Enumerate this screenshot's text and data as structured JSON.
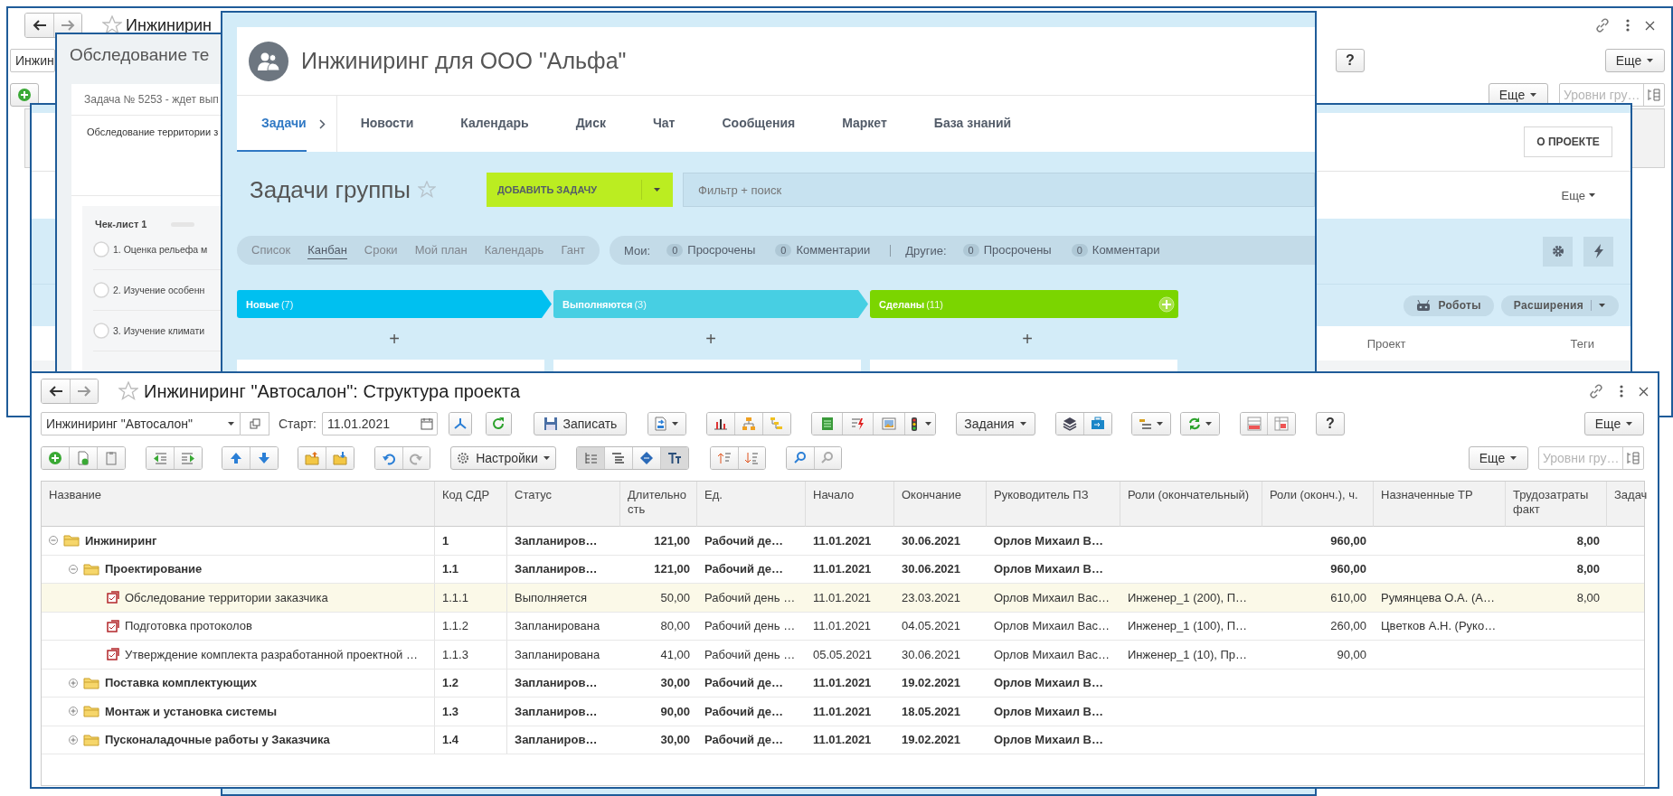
{
  "back_window": {
    "title": "Инжинирин",
    "project_field": "Инжин",
    "help_button": "?",
    "more_button": "Еще",
    "table_more_button": "Еще",
    "levels_field": {
      "placeholder": "Уровни гру…"
    }
  },
  "project_window": {
    "about_button": "О ПРОЕКТЕ",
    "more_menu": "Еще",
    "robots_button": "Роботы",
    "extensions_button": "Расширения",
    "columns": [
      "Проект",
      "Теги"
    ]
  },
  "task_window": {
    "title": "Обследование те",
    "task_line": "Задача № 5253 - ждет вып",
    "description": "Обследование территории з",
    "checklist": {
      "title": "Чек-лист 1",
      "progress": {
        "level": 0
      },
      "items": [
        {
          "text": "1. Оценка рельефа м",
          "checked": false
        },
        {
          "text": "2. Изучение особенн",
          "checked": false
        },
        {
          "text": "3. Изучение климати",
          "checked": false
        }
      ]
    }
  },
  "group_window": {
    "title": "Инжиниринг для ООО \"Альфа\"",
    "nav": [
      {
        "label": "Задачи",
        "selected": true
      },
      {
        "label": "Новости",
        "selected": false
      },
      {
        "label": "Календарь",
        "selected": false
      },
      {
        "label": "Диск",
        "selected": false
      },
      {
        "label": "Чат",
        "selected": false
      },
      {
        "label": "Сообщения",
        "selected": false
      },
      {
        "label": "Маркет",
        "selected": false
      },
      {
        "label": "База знаний",
        "selected": false
      }
    ],
    "heading": "Задачи группы",
    "add_button": "ДОБАВИТЬ ЗАДАЧУ",
    "filter": {
      "placeholder": "Фильтр + поиск"
    },
    "views": [
      {
        "label": "Список",
        "selected": false
      },
      {
        "label": "Канбан",
        "selected": true
      },
      {
        "label": "Сроки",
        "selected": false
      },
      {
        "label": "Мой план",
        "selected": false
      },
      {
        "label": "Календарь",
        "selected": false
      },
      {
        "label": "Гант",
        "selected": false
      }
    ],
    "counters": {
      "mine_label": "Мои:",
      "mine": [
        {
          "count": "0",
          "label": "Просрочены"
        },
        {
          "count": "0",
          "label": "Комментарии"
        }
      ],
      "others_label": "Другие:",
      "others": [
        {
          "count": "0",
          "label": "Просрочены"
        },
        {
          "count": "0",
          "label": "Комментари"
        }
      ]
    },
    "stages": [
      {
        "name": "Новые",
        "count": "(7)",
        "color": "#00c0f0",
        "add": "+"
      },
      {
        "name": "Выполняются",
        "count": "(3)",
        "color": "#47cfe3",
        "add": "+"
      },
      {
        "name": "Сделаны",
        "count": "(11)",
        "color": "#7bd500",
        "add": "+"
      }
    ]
  },
  "structure_window": {
    "title": "Инжиниринг \"Автосалон\": Структура проекта",
    "project_field": "Инжиниринг \"Автосалон\"",
    "start_label": "Старт:",
    "start_date": "11.01.2021",
    "save_button": "Записать",
    "tasks_button": "Задания",
    "help_button": "?",
    "more_button": "Еще",
    "settings_button": "Настройки",
    "table_more_button": "Еще",
    "levels_field": {
      "placeholder": "Уровни гру…"
    },
    "view_modes": [
      {
        "kind": "tree",
        "selected": true
      },
      {
        "kind": "list",
        "selected": false
      },
      {
        "kind": "diagram",
        "selected": false
      },
      {
        "kind": "text",
        "selected": true
      }
    ],
    "columns": [
      "Название",
      "Код СДР",
      "Статус",
      "Длительность",
      "Ед.",
      "Начало",
      "Окончание",
      "Руководитель ПЗ",
      "Роли (окончательный)",
      "Роли (оконч.), ч.",
      "Назначенные ТР",
      "Трудозатраты факт",
      "Задач"
    ],
    "rows": [
      {
        "kind": "group",
        "expanded": true,
        "selected": false,
        "name": "Инжиниринг",
        "code": "1",
        "status": "Запланиров…",
        "duration": "121,00",
        "unit": "Рабочий де…",
        "start": "11.01.2021",
        "end": "30.06.2021",
        "manager": "Орлов Михаил В…",
        "roles_hours": "960,00",
        "labor_fact": "8,00",
        "children": [
          {
            "kind": "group",
            "expanded": true,
            "selected": false,
            "name": "Проектирование",
            "code": "1.1",
            "status": "Запланиров…",
            "duration": "121,00",
            "unit": "Рабочий де…",
            "start": "11.01.2021",
            "end": "30.06.2021",
            "manager": "Орлов Михаил В…",
            "roles_hours": "960,00",
            "labor_fact": "8,00",
            "children": [
              {
                "kind": "task",
                "selected": true,
                "name": "Обследование территории заказчика",
                "code": "1.1.1",
                "status": "Выполняется",
                "duration": "50,00",
                "unit": "Рабочий день …",
                "start": "11.01.2021",
                "end": "23.03.2021",
                "manager": "Орлов Михаил Вас…",
                "roles": "Инженер_1 (200), П…",
                "roles_hours": "610,00",
                "assigned": "Румянцева О.А. (А…",
                "labor_fact": "8,00"
              },
              {
                "kind": "task",
                "selected": false,
                "name": "Подготовка протоколов",
                "code": "1.1.2",
                "status": "Запланирована",
                "duration": "80,00",
                "unit": "Рабочий день …",
                "start": "11.01.2021",
                "end": "04.05.2021",
                "manager": "Орлов Михаил Вас…",
                "roles": "Инженер_1 (100), П…",
                "roles_hours": "260,00",
                "assigned": "Цветков А.Н. (Руко…"
              },
              {
                "kind": "task",
                "selected": false,
                "name": "Утверждение комплекта разработанной проектной …",
                "code": "1.1.3",
                "status": "Запланирована",
                "duration": "41,00",
                "unit": "Рабочий день …",
                "start": "05.05.2021",
                "end": "30.06.2021",
                "manager": "Орлов Михаил Вас…",
                "roles": "Инженер_1 (10), Пр…",
                "roles_hours": "90,00"
              }
            ]
          },
          {
            "kind": "group",
            "expanded": false,
            "selected": false,
            "name": "Поставка комплектующих",
            "code": "1.2",
            "status": "Запланиров…",
            "duration": "30,00",
            "unit": "Рабочий де…",
            "start": "11.01.2021",
            "end": "19.02.2021",
            "manager": "Орлов Михаил В…"
          },
          {
            "kind": "group",
            "expanded": false,
            "selected": false,
            "name": "Монтаж и установка системы",
            "code": "1.3",
            "status": "Запланиров…",
            "duration": "90,00",
            "unit": "Рабочий де…",
            "start": "11.01.2021",
            "end": "18.05.2021",
            "manager": "Орлов Михаил В…"
          },
          {
            "kind": "group",
            "expanded": false,
            "selected": false,
            "name": "Пусконаладочные работы у Заказчика",
            "code": "1.4",
            "status": "Запланиров…",
            "duration": "30,00",
            "unit": "Рабочий де…",
            "start": "11.01.2021",
            "end": "19.02.2021",
            "manager": "Орлов Михаил В…"
          }
        ]
      }
    ]
  }
}
